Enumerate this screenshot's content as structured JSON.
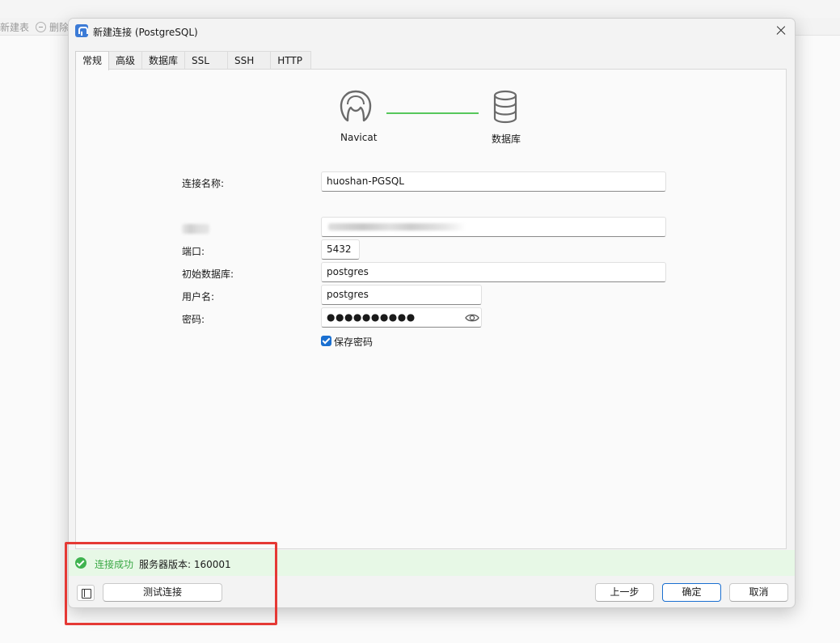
{
  "background": {
    "toolbar": {
      "new_table_label": "新建表",
      "delete_label": "删除"
    }
  },
  "dialog": {
    "title": "新建连接 (PostgreSQL)",
    "tabs": [
      "常规",
      "高级",
      "数据库",
      "SSL",
      "SSH",
      "HTTP"
    ],
    "active_tab": "常规",
    "diagram": {
      "left_label": "Navicat",
      "right_label": "数据库",
      "line_color": "#56c75b"
    },
    "form": {
      "connection_name_label": "连接名称:",
      "connection_name_value": "huoshan-PGSQL",
      "port_label": "端口:",
      "port_value": "5432",
      "initial_db_label": "初始数据库:",
      "initial_db_value": "postgres",
      "username_label": "用户名:",
      "username_value": "postgres",
      "password_label": "密码:",
      "password_value": "●●●●●●●●●●",
      "save_password_label": "保存密码",
      "save_password_checked": true
    },
    "status": {
      "success_text": "连接成功",
      "server_version_text": "服务器版本: 160001",
      "success_color": "#3aa845"
    },
    "buttons": {
      "test_connection": "测试连接",
      "previous": "上一步",
      "ok": "确定",
      "cancel": "取消"
    }
  },
  "colors": {
    "accent": "#1a6fd0",
    "highlight": "#e53935"
  }
}
